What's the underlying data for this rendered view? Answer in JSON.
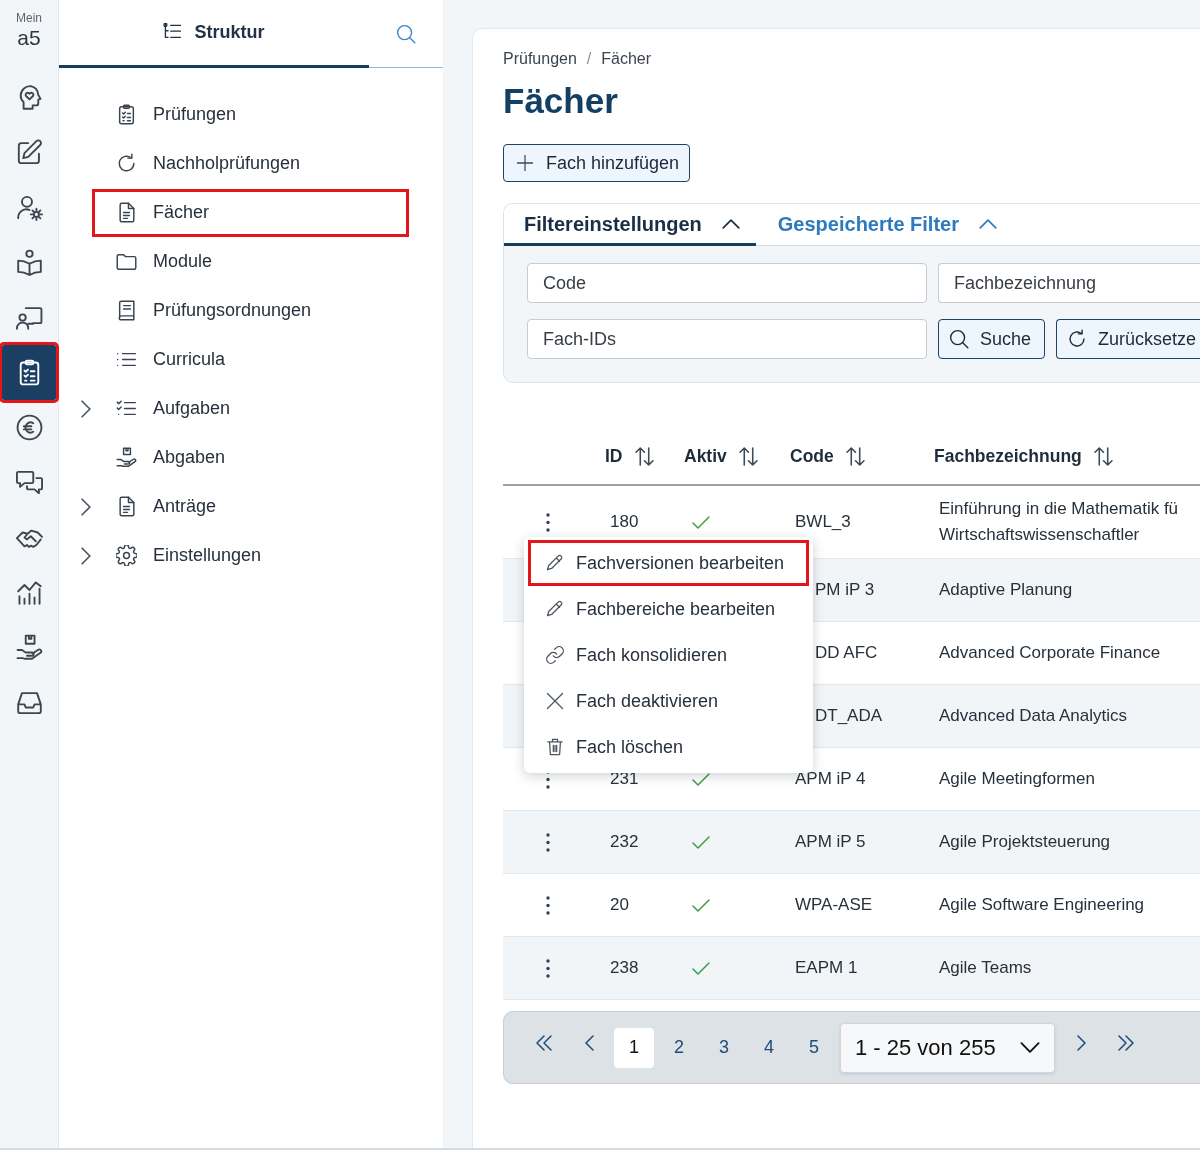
{
  "nav_rail": {
    "logo": {
      "caption": "Mein",
      "text": "a5"
    },
    "items": [
      {
        "selected": false,
        "highlighted": false
      },
      {
        "selected": false,
        "highlighted": false
      },
      {
        "selected": false,
        "highlighted": false
      },
      {
        "selected": false,
        "highlighted": false
      },
      {
        "selected": false,
        "highlighted": false
      },
      {
        "selected": true,
        "highlighted": true
      },
      {
        "selected": false,
        "highlighted": false
      },
      {
        "selected": false,
        "highlighted": false
      },
      {
        "selected": false,
        "highlighted": false
      },
      {
        "selected": false,
        "highlighted": false
      },
      {
        "selected": false,
        "highlighted": false
      },
      {
        "selected": false,
        "highlighted": false
      }
    ]
  },
  "sidebar": {
    "tab": {
      "label": "Struktur",
      "selected": true
    },
    "items": [
      {
        "label": "Prüfungen",
        "expandable": false,
        "highlighted": false
      },
      {
        "label": "Nachholprüfungen",
        "expandable": false,
        "highlighted": false
      },
      {
        "label": "Fächer",
        "expandable": false,
        "highlighted": true
      },
      {
        "label": "Module",
        "expandable": false,
        "highlighted": false
      },
      {
        "label": "Prüfungsordnungen",
        "expandable": false,
        "highlighted": false
      },
      {
        "label": "Curricula",
        "expandable": false,
        "highlighted": false
      },
      {
        "label": "Aufgaben",
        "expandable": true,
        "highlighted": false
      },
      {
        "label": "Abgaben",
        "expandable": false,
        "highlighted": false
      },
      {
        "label": "Anträge",
        "expandable": true,
        "highlighted": false
      },
      {
        "label": "Einstellungen",
        "expandable": true,
        "highlighted": false
      }
    ]
  },
  "breadcrumb": {
    "items": [
      "Prüfungen",
      "Fächer"
    ],
    "separator": "/"
  },
  "title": "Fächer",
  "add_button": {
    "label": "Fach hinzufügen"
  },
  "filter": {
    "tabs": [
      {
        "label": "Filtereinstellungen",
        "selected": true
      },
      {
        "label": "Gespeicherte Filter",
        "selected": false
      }
    ],
    "fields": [
      {
        "placeholder": "Code"
      },
      {
        "placeholder": "Fachbezeichnung"
      },
      {
        "placeholder": "Fach-IDs"
      }
    ],
    "buttons": [
      {
        "label": "Suche",
        "kind": "search"
      },
      {
        "label": "Zurücksetze",
        "kind": "reset"
      }
    ]
  },
  "table": {
    "columns": [
      "ID",
      "Aktiv",
      "Code",
      "Fachbezeichnung"
    ],
    "rows": [
      {
        "id": "180",
        "active": true,
        "code": "BWL_3",
        "name": "Einführung in die Mathematik fü\nWirtschaftswissenschaftler"
      },
      {
        "code": "PM iP 3",
        "name": "Adaptive Planung"
      },
      {
        "code": "DD AFC",
        "name": "Advanced Corporate Finance"
      },
      {
        "code": "DT_ADA",
        "name": "Advanced Data Analytics"
      },
      {
        "id": "231",
        "active": true,
        "code": "APM iP 4",
        "name": "Agile Meetingformen"
      },
      {
        "id": "232",
        "active": true,
        "code": "APM iP 5",
        "name": "Agile Projektsteuerung"
      },
      {
        "id": "20",
        "active": true,
        "code": "WPA-ASE",
        "name": "Agile Software Engineering"
      },
      {
        "id": "238",
        "active": true,
        "code": "EAPM 1",
        "name": "Agile Teams"
      }
    ]
  },
  "context_menu": {
    "items": [
      {
        "label": "Fachversionen bearbeiten",
        "highlighted": true
      },
      {
        "label": "Fachbereiche bearbeiten",
        "highlighted": false
      },
      {
        "label": "Fach konsolidieren",
        "highlighted": false
      },
      {
        "label": "Fach deaktivieren",
        "highlighted": false
      },
      {
        "label": "Fach löschen",
        "highlighted": false
      }
    ]
  },
  "pagination": {
    "pages": [
      {
        "label": "1",
        "selected": true
      },
      {
        "label": "2",
        "selected": false
      },
      {
        "label": "3",
        "selected": false
      },
      {
        "label": "4",
        "selected": false
      },
      {
        "label": "5",
        "selected": false
      }
    ],
    "range": "1 - 25 von 255"
  }
}
